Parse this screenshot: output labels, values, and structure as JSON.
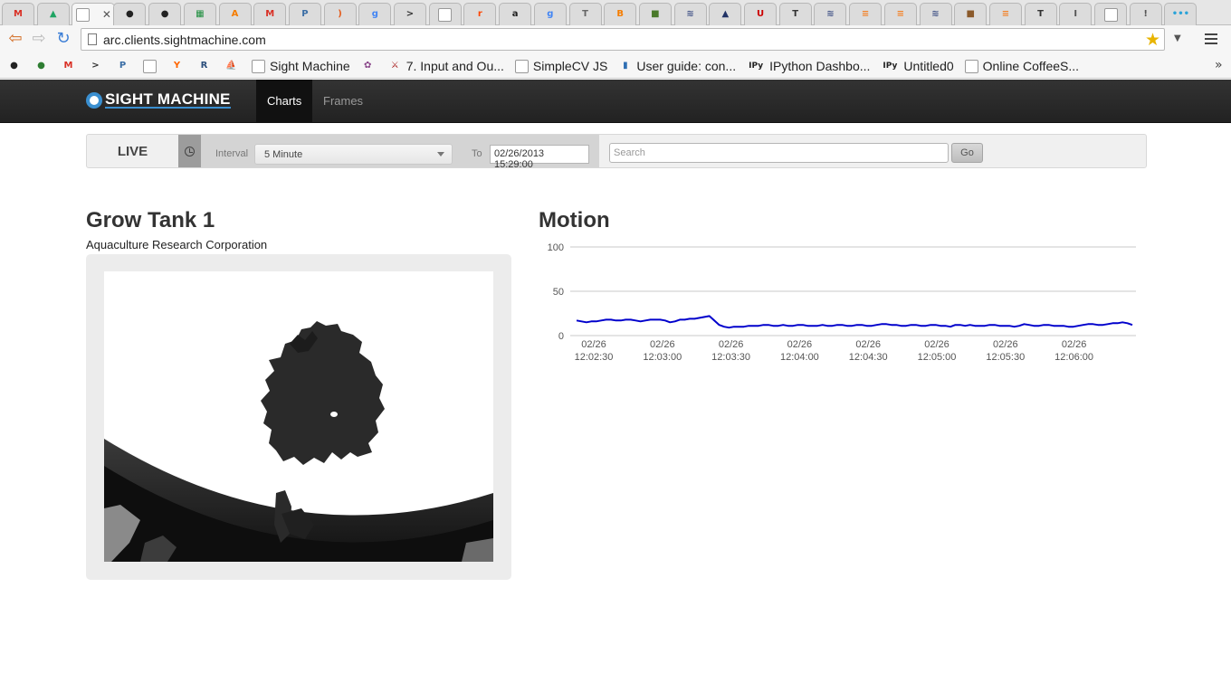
{
  "browser": {
    "tabs": [
      {
        "icon": "gmail-icon",
        "letter": "M",
        "color": "#d93025"
      },
      {
        "icon": "google-drive-icon",
        "letter": "▲",
        "color": "#1fa463"
      },
      {
        "icon": "page-icon",
        "letter": "",
        "color": "#ffffff",
        "active": true
      },
      {
        "icon": "github-icon",
        "letter": "●",
        "color": "#222222"
      },
      {
        "icon": "github-icon",
        "letter": "●",
        "color": "#222222"
      },
      {
        "icon": "spreadsheet-icon",
        "letter": "▦",
        "color": "#1e8e3e"
      },
      {
        "icon": "a-orange-icon",
        "letter": "A",
        "color": "#f57c00"
      },
      {
        "icon": "gmail-icon",
        "letter": "M",
        "color": "#d93025"
      },
      {
        "icon": "p-icon",
        "letter": "P",
        "color": "#3b6ea5"
      },
      {
        "icon": "moon-icon",
        "letter": ")",
        "color": "#e45c1c"
      },
      {
        "icon": "google-icon",
        "letter": "g",
        "color": "#4285f4"
      },
      {
        "icon": "terminal-icon",
        "letter": ">",
        "color": "#333333"
      },
      {
        "icon": "page-icon",
        "letter": "",
        "color": "#ffffff"
      },
      {
        "icon": "reddit-icon",
        "letter": "r",
        "color": "#ff4500"
      },
      {
        "icon": "amazon-icon",
        "letter": "a",
        "color": "#222222"
      },
      {
        "icon": "google-icon",
        "letter": "g",
        "color": "#4285f4"
      },
      {
        "icon": "tex-icon",
        "letter": "T",
        "color": "#666666"
      },
      {
        "icon": "blogger-icon",
        "letter": "B",
        "color": "#f57d00"
      },
      {
        "icon": "cube-icon",
        "letter": "■",
        "color": "#4a7a2a"
      },
      {
        "icon": "wave-icon",
        "letter": "≋",
        "color": "#445588"
      },
      {
        "icon": "image-icon",
        "letter": "▲",
        "color": "#223366"
      },
      {
        "icon": "u-icon",
        "letter": "U",
        "color": "#cc0000"
      },
      {
        "icon": "tex-icon",
        "letter": "T",
        "color": "#333333"
      },
      {
        "icon": "wave-icon",
        "letter": "≋",
        "color": "#445588"
      },
      {
        "icon": "stackoverflow-icon",
        "letter": "≡",
        "color": "#f48024"
      },
      {
        "icon": "stackoverflow-icon",
        "letter": "≡",
        "color": "#f48024"
      },
      {
        "icon": "wave-icon",
        "letter": "≋",
        "color": "#445588"
      },
      {
        "icon": "box-icon",
        "letter": "■",
        "color": "#8b5a2b"
      },
      {
        "icon": "stackoverflow-icon",
        "letter": "≡",
        "color": "#f48024"
      },
      {
        "icon": "tex-icon",
        "letter": "T",
        "color": "#333333"
      },
      {
        "icon": "bar-icon",
        "letter": "I",
        "color": "#555555"
      },
      {
        "icon": "page-icon",
        "letter": "",
        "color": "#ffffff"
      },
      {
        "icon": "bar-icon",
        "letter": "!",
        "color": "#555555"
      },
      {
        "icon": "dots-icon",
        "letter": "•••",
        "color": "#2aa3d8"
      }
    ],
    "url": "arc.clients.sightmachine.com",
    "bookmarks": [
      {
        "label": "",
        "icon": "github-icon",
        "letter": "●",
        "color": "#222222"
      },
      {
        "label": "",
        "icon": "green-circle-icon",
        "letter": "●",
        "color": "#2e7d32"
      },
      {
        "label": "",
        "icon": "gmail-icon",
        "letter": "M",
        "color": "#d93025"
      },
      {
        "label": "",
        "icon": "terminal-icon",
        "letter": ">",
        "color": "#333333"
      },
      {
        "label": "",
        "icon": "p-icon",
        "letter": "P",
        "color": "#3b6ea5"
      },
      {
        "label": "",
        "icon": "page-icon",
        "letter": "",
        "color": "#ffffff"
      },
      {
        "label": "",
        "icon": "ycombinator-icon",
        "letter": "Y",
        "color": "#ff6600"
      },
      {
        "label": "",
        "icon": "r-icon",
        "letter": "R",
        "color": "#2c4f7c"
      },
      {
        "label": "",
        "icon": "boat-icon",
        "letter": "⛵",
        "color": "#555555"
      },
      {
        "label": "Sight Machine",
        "icon": "page-icon",
        "letter": "",
        "color": "#ffffff"
      },
      {
        "label": "",
        "icon": "palette-icon",
        "letter": "✿",
        "color": "#884488"
      },
      {
        "label": "7. Input and Ou...",
        "icon": "python-doc-icon",
        "letter": "⚔",
        "color": "#aa2222"
      },
      {
        "label": "SimpleCV JS",
        "icon": "page-icon",
        "letter": "",
        "color": "#ffffff"
      },
      {
        "label": "User guide: con...",
        "icon": "chart-icon",
        "letter": "▮",
        "color": "#2f6fb3"
      },
      {
        "label": "IPython Dashbo...",
        "icon": "ipython-icon",
        "letter": "IPy",
        "color": "#222222"
      },
      {
        "label": "Untitled0",
        "icon": "ipython-icon",
        "letter": "IPy",
        "color": "#222222"
      },
      {
        "label": "Online CoffeeS...",
        "icon": "page-icon",
        "letter": "",
        "color": "#ffffff"
      }
    ]
  },
  "app": {
    "brand": "SIGHT MACHINE",
    "nav": [
      {
        "label": "Charts",
        "active": true
      },
      {
        "label": "Frames",
        "active": false
      }
    ],
    "filter": {
      "live_label": "LIVE",
      "interval_label": "Interval",
      "interval_value": "5 Minute",
      "to_label": "To",
      "to_value": "02/26/2013 15:29:00",
      "search_placeholder": "Search",
      "go_label": "Go"
    },
    "left_panel": {
      "title": "Grow Tank 1",
      "subtitle": "Aquaculture Research Corporation"
    },
    "right_panel": {
      "title": "Motion"
    }
  },
  "chart_data": {
    "type": "line",
    "title": "Motion",
    "xlabel": "",
    "ylabel": "",
    "ylim": [
      0,
      100
    ],
    "y_ticks": [
      0,
      50,
      100
    ],
    "x_tick_labels": [
      [
        "02/26",
        "12:02:30"
      ],
      [
        "02/26",
        "12:03:00"
      ],
      [
        "02/26",
        "12:03:30"
      ],
      [
        "02/26",
        "12:04:00"
      ],
      [
        "02/26",
        "12:04:30"
      ],
      [
        "02/26",
        "12:05:00"
      ],
      [
        "02/26",
        "12:05:30"
      ],
      [
        "02/26",
        "12:06:00"
      ]
    ],
    "x_seconds_start": "12:02:21",
    "x_seconds_step": 2,
    "grid": "horizontal",
    "series": [
      {
        "color": "#0000cc",
        "values": [
          17,
          16,
          15,
          16,
          16,
          17,
          18,
          18,
          17,
          17,
          18,
          18,
          17,
          16,
          17,
          18,
          18,
          18,
          17,
          15,
          16,
          18,
          18,
          19,
          19,
          20,
          21,
          22,
          17,
          12,
          10,
          9,
          10,
          10,
          10,
          11,
          11,
          11,
          12,
          12,
          11,
          11,
          12,
          11,
          11,
          12,
          12,
          11,
          11,
          11,
          12,
          11,
          11,
          12,
          12,
          11,
          11,
          12,
          12,
          11,
          11,
          12,
          13,
          13,
          12,
          12,
          11,
          11,
          12,
          12,
          11,
          11,
          12,
          12,
          11,
          11,
          10,
          12,
          12,
          11,
          12,
          11,
          11,
          11,
          12,
          12,
          11,
          11,
          11,
          10,
          11,
          13,
          12,
          11,
          11,
          12,
          12,
          11,
          11,
          11,
          10,
          10,
          11,
          12,
          13,
          13,
          12,
          12,
          13,
          14,
          14,
          15,
          14,
          12
        ]
      }
    ]
  }
}
